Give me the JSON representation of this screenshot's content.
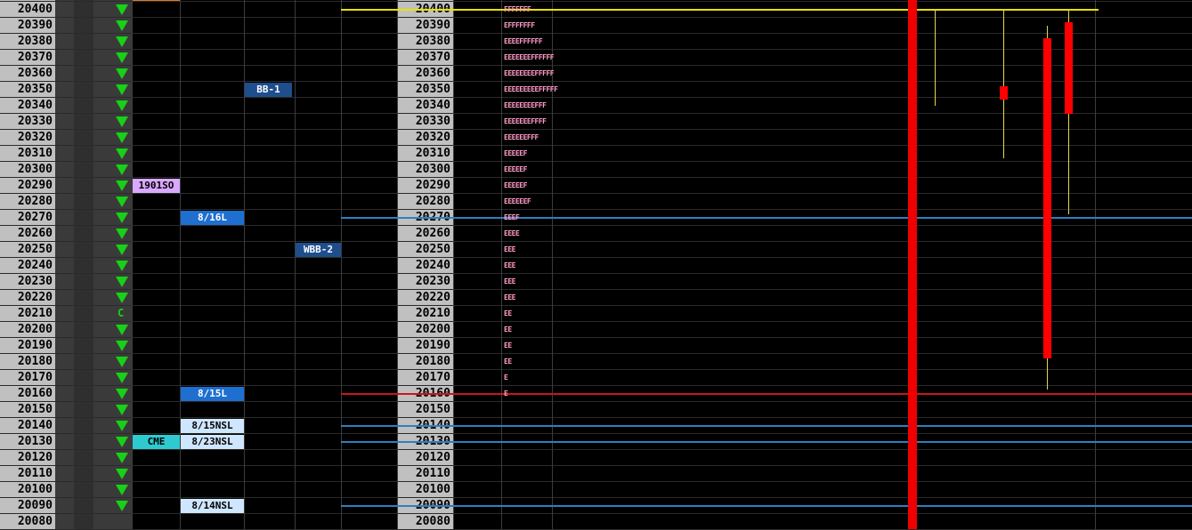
{
  "price_ladder": [
    "20400",
    "20390",
    "20380",
    "20370",
    "20360",
    "20350",
    "20340",
    "20330",
    "20320",
    "20310",
    "20300",
    "20290",
    "20280",
    "20270",
    "20260",
    "20250",
    "20240",
    "20230",
    "20220",
    "20210",
    "20200",
    "20190",
    "20180",
    "20170",
    "20160",
    "20150",
    "20140",
    "20130",
    "20120",
    "20110",
    "20100",
    "20090",
    "20080"
  ],
  "marker_c": {
    "row": 19,
    "text": "C"
  },
  "tags": [
    {
      "id": "bb1",
      "text": "BB-1",
      "row": 5,
      "bg": "#1e4e8c",
      "fg": "#ffffff"
    },
    {
      "id": "1901so",
      "text": "1901SO",
      "row": 11,
      "bg": "#d9a8ff",
      "fg": "#000000"
    },
    {
      "id": "816l",
      "text": "8/16L",
      "row": 13,
      "bg": "#1e6fd0",
      "fg": "#ffffff"
    },
    {
      "id": "wbb2",
      "text": "WBB-2",
      "row": 15,
      "bg": "#1e4e8c",
      "fg": "#ffffff"
    },
    {
      "id": "815l",
      "text": "8/15L",
      "row": 24,
      "bg": "#1e6fd0",
      "fg": "#ffffff"
    },
    {
      "id": "815nsl",
      "text": "8/15NSL",
      "row": 26,
      "bg": "#cfe6ff",
      "fg": "#000000"
    },
    {
      "id": "cme",
      "text": "CME",
      "row": 27,
      "bg": "#2ecad0",
      "fg": "#000000"
    },
    {
      "id": "823nsl",
      "text": "8/23NSL",
      "row": 27,
      "bg": "#cfe6ff",
      "fg": "#000000"
    },
    {
      "id": "814nsl",
      "text": "8/14NSL",
      "row": 31,
      "bg": "#cfe6ff",
      "fg": "#000000"
    }
  ],
  "profile": [
    {
      "row": 0,
      "text": "FFFFFFF"
    },
    {
      "row": 1,
      "text": "EFFFFFFF"
    },
    {
      "row": 2,
      "text": "EEEEFFFFFF"
    },
    {
      "row": 3,
      "text": "EEEEEEEFFFFFF"
    },
    {
      "row": 4,
      "text": "EEEEEEEEFFFFF"
    },
    {
      "row": 5,
      "text": "EEEEEEEEEFFFFF"
    },
    {
      "row": 6,
      "text": "EEEEEEEEFFF"
    },
    {
      "row": 7,
      "text": "EEEEEEEFFFF"
    },
    {
      "row": 8,
      "text": "EEEEEEFFF"
    },
    {
      "row": 9,
      "text": "EEEEEF"
    },
    {
      "row": 10,
      "text": "EEEEEF"
    },
    {
      "row": 11,
      "text": "EEEEEF"
    },
    {
      "row": 12,
      "text": "EEEEEEF"
    },
    {
      "row": 13,
      "text": "EEEF"
    },
    {
      "row": 14,
      "text": "EEEE"
    },
    {
      "row": 15,
      "text": "EEE"
    },
    {
      "row": 16,
      "text": "EEE"
    },
    {
      "row": 17,
      "text": "EEE"
    },
    {
      "row": 18,
      "text": "EEE"
    },
    {
      "row": 19,
      "text": "EE"
    },
    {
      "row": 20,
      "text": "EE"
    },
    {
      "row": 21,
      "text": "EE"
    },
    {
      "row": 22,
      "text": "EE"
    },
    {
      "row": 23,
      "text": "E"
    },
    {
      "row": 24,
      "text": "E"
    }
  ],
  "levels": [
    {
      "id": "yellow-20400",
      "price": 20400,
      "color": "#e8e000"
    },
    {
      "id": "blue-20270",
      "price": 20270,
      "color": "#2f7fc0"
    },
    {
      "id": "red-20160",
      "price": 20160,
      "color": "#c81818"
    },
    {
      "id": "blue-20140",
      "price": 20140,
      "color": "#2f7fc0"
    },
    {
      "id": "blue-20130",
      "price": 20130,
      "color": "#2f7fc0"
    },
    {
      "id": "blue-20090",
      "price": 20090,
      "color": "#2f7fc0"
    }
  ],
  "candles": [
    {
      "id": "candle-1",
      "open": 20344,
      "close": 20352,
      "high": 20400,
      "low": 20307
    },
    {
      "id": "candle-2",
      "open": 20182,
      "close": 20382,
      "high": 20390,
      "low": 20163
    },
    {
      "id": "candle-3",
      "open": 20335,
      "close": 20392,
      "high": 20400,
      "low": 20272
    }
  ],
  "colors": {
    "price_bg": "#c0c0c0",
    "triangle": "#18d018",
    "big_bar": "#ee0000",
    "profile": "#ff9cc8"
  }
}
